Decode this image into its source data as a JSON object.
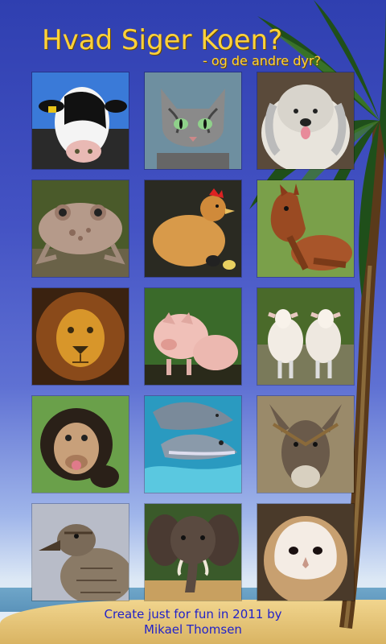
{
  "app": {
    "title": "Hvad Siger Koen?",
    "subtitle": "- og de andre dyr?"
  },
  "animals": [
    {
      "name": "cow",
      "icon": "cow-icon"
    },
    {
      "name": "cat",
      "icon": "cat-icon"
    },
    {
      "name": "dog",
      "icon": "dog-icon"
    },
    {
      "name": "frog",
      "icon": "frog-icon"
    },
    {
      "name": "hen",
      "icon": "hen-icon"
    },
    {
      "name": "horse",
      "icon": "horse-icon"
    },
    {
      "name": "lion",
      "icon": "lion-icon"
    },
    {
      "name": "pig",
      "icon": "pig-icon"
    },
    {
      "name": "sheep",
      "icon": "sheep-icon"
    },
    {
      "name": "chimpanzee",
      "icon": "chimpanzee-icon"
    },
    {
      "name": "dolphin",
      "icon": "dolphin-icon"
    },
    {
      "name": "donkey",
      "icon": "donkey-icon"
    },
    {
      "name": "duck",
      "icon": "duck-icon"
    },
    {
      "name": "elephant",
      "icon": "elephant-icon"
    },
    {
      "name": "owl",
      "icon": "owl-icon"
    }
  ],
  "credits": {
    "line1": "Create just for fun in 2011 by",
    "line2": "Mikael Thomsen"
  },
  "colors": {
    "title": "#ffd23a",
    "credit": "#2222c8",
    "sky": "#3b4bbd"
  }
}
